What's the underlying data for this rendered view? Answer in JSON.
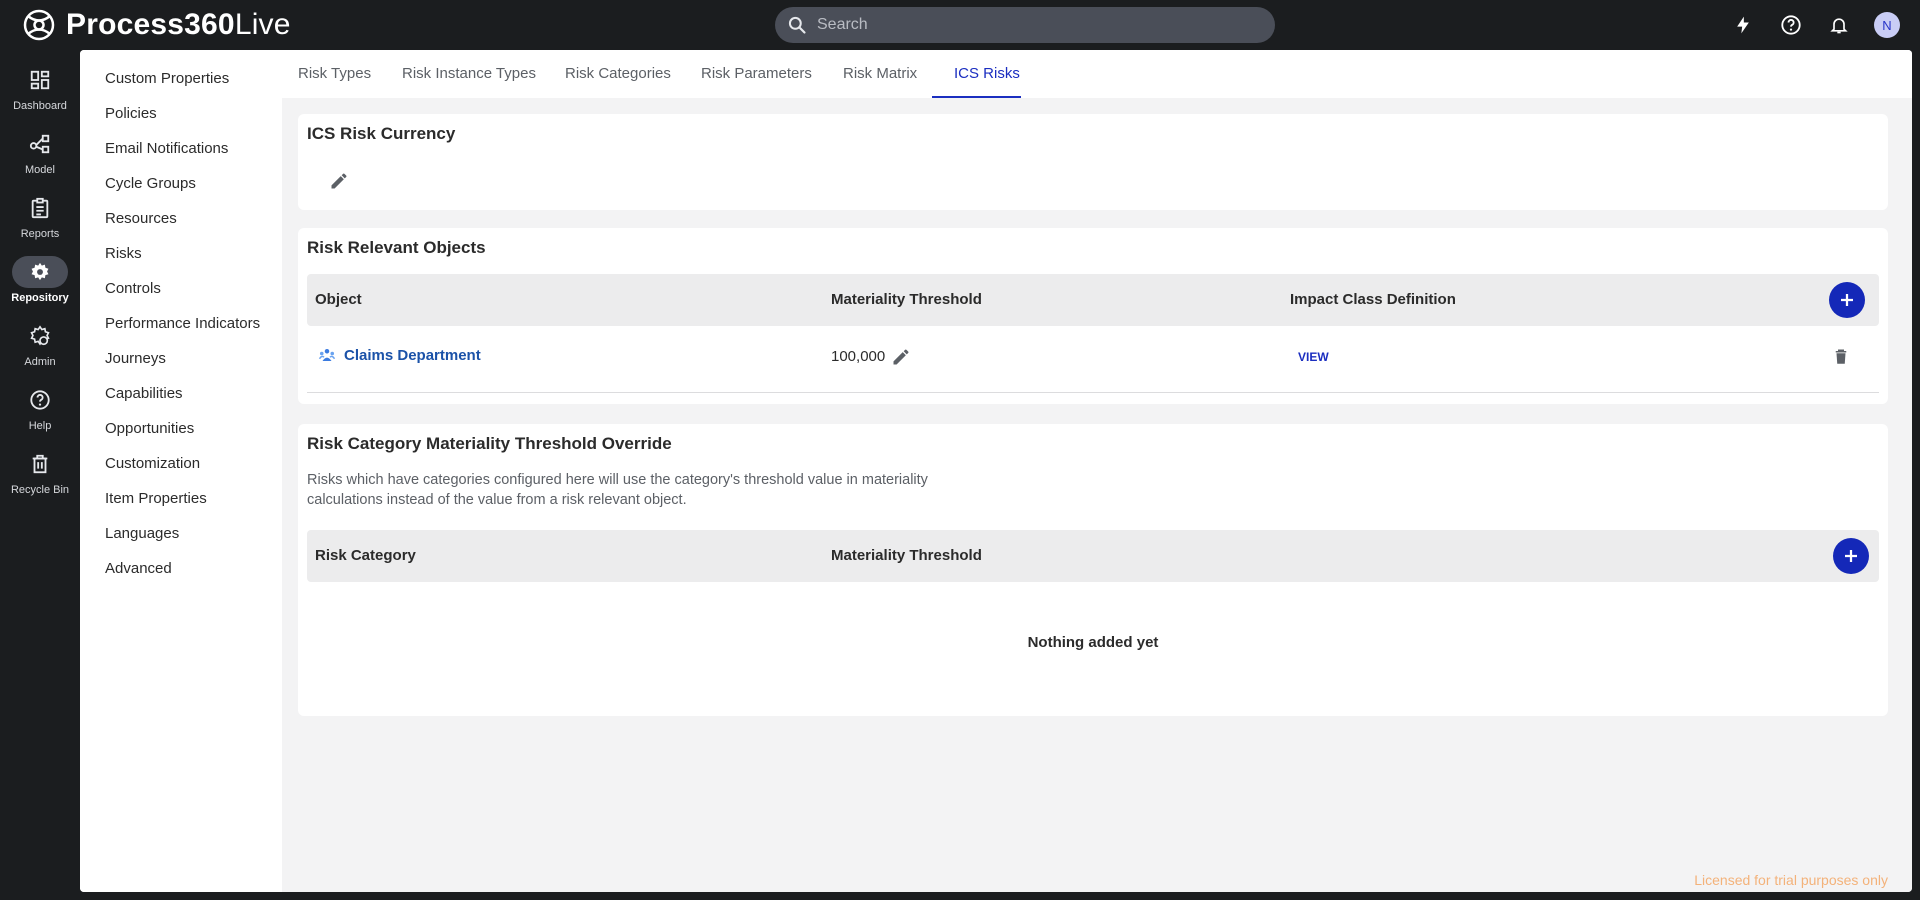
{
  "app": {
    "name_bold": "Process360",
    "name_light": "Live"
  },
  "search": {
    "placeholder": "Search"
  },
  "user": {
    "initial": "N"
  },
  "rail": [
    {
      "label": "Dashboard",
      "icon": "dashboard-icon"
    },
    {
      "label": "Model",
      "icon": "model-icon"
    },
    {
      "label": "Reports",
      "icon": "reports-icon"
    },
    {
      "label": "Repository",
      "icon": "gear-icon",
      "active": true
    },
    {
      "label": "Admin",
      "icon": "admin-icon"
    },
    {
      "label": "Help",
      "icon": "help-icon"
    },
    {
      "label": "Recycle Bin",
      "icon": "trash-icon"
    }
  ],
  "subnav": [
    "Custom Properties",
    "Policies",
    "Email Notifications",
    "Cycle Groups",
    "Resources",
    "Risks",
    "Controls",
    "Performance Indicators",
    "Journeys",
    "Capabilities",
    "Opportunities",
    "Customization",
    "Item Properties",
    "Languages",
    "Advanced"
  ],
  "tabs": [
    "Risk Types",
    "Risk Instance Types",
    "Risk Categories",
    "Risk Parameters",
    "Risk Matrix",
    "ICS Risks"
  ],
  "active_tab": "ICS Risks",
  "currency_card": {
    "title": "ICS Risk Currency"
  },
  "rro_card": {
    "title": "Risk Relevant Objects",
    "headers": {
      "object": "Object",
      "threshold": "Materiality Threshold",
      "impact": "Impact Class Definition"
    },
    "rows": [
      {
        "object": "Claims Department",
        "threshold": "100,000",
        "impact_action": "VIEW"
      }
    ]
  },
  "override_card": {
    "title": "Risk Category Materiality Threshold Override",
    "description": "Risks which have categories configured here will use the category's threshold value in materiality calculations instead of the value from a risk relevant object.",
    "headers": {
      "category": "Risk Category",
      "threshold": "Materiality Threshold"
    },
    "empty_text": "Nothing added yet"
  },
  "footer": {
    "license": "Licensed for trial purposes only"
  },
  "colors": {
    "accent": "#1428b8",
    "rail_bg": "#1b1d1f",
    "link": "#1b52a8",
    "license": "#f3b27a"
  }
}
